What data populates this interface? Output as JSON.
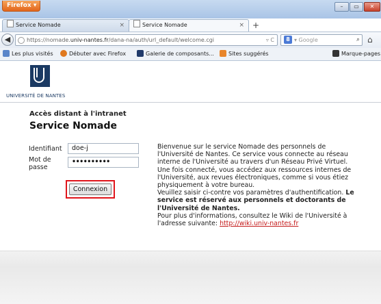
{
  "browser": {
    "menu_label": "Firefox ▾",
    "window_controls": {
      "minimize": "–",
      "maximize": "▭",
      "close": "✕"
    },
    "tabs": [
      {
        "label": "Service Nomade",
        "active": false
      },
      {
        "label": "Service Nomade",
        "active": true
      }
    ],
    "new_tab": "+",
    "url_prefix": "https://nomade.",
    "url_host": "univ-nantes.fr",
    "url_path": "/dana-na/auth/url_default/welcome.cgi",
    "url_right": "▿ C",
    "search_engine": "8",
    "search_placeholder": "▾ Google",
    "bookmarks": [
      {
        "label": "Les plus visités",
        "icon": "bookmark-icon",
        "color": "#5b86c9"
      },
      {
        "label": "Débuter avec Firefox",
        "icon": "firefox-icon",
        "color": "#e0791f"
      },
      {
        "label": "Galerie de composants...",
        "icon": "gallery-icon",
        "color": "#203a6a"
      },
      {
        "label": "Sites suggérés",
        "icon": "suggested-icon",
        "color": "#e8852a"
      },
      {
        "label": "Marque-pages",
        "icon": "bookmarks-menu-icon",
        "color": "#333333"
      }
    ]
  },
  "header": {
    "logo_text": "UNIVERSITÉ DE NANTES",
    "brand_color": "#1b3a63"
  },
  "main": {
    "subtitle": "Accès distant à l'intranet",
    "title": "Service Nomade",
    "form": {
      "username_label": "Identifiant",
      "username_value": "doe-j",
      "password_label_1": "Mot de",
      "password_label_2": "passe",
      "password_value": "••••••••••",
      "submit_label": "Connexion"
    },
    "info": {
      "p1": "Bienvenue sur le service Nomade des personnels de l'Université de Nantes. Ce service vous connecte au réseau interne de l'Université au travers d'un Réseau Privé Virtuel. Une fois connecté, vous accédez aux ressources internes de l'Université, aux revues électroniques, comme si vous étiez physiquement à votre bureau.",
      "p2_plain": "Veuillez saisir ci-contre vos paramètres d'authentification.",
      "p2_bold": "Le service est réservé aux personnels et doctorants de l'Université de Nantes.",
      "p3": "Pour plus d'informations, consultez le Wiki de l'Université à l'adresse suivante:",
      "link": "http://wiki.univ-nantes.fr"
    },
    "highlight_color": "#e0141a"
  }
}
